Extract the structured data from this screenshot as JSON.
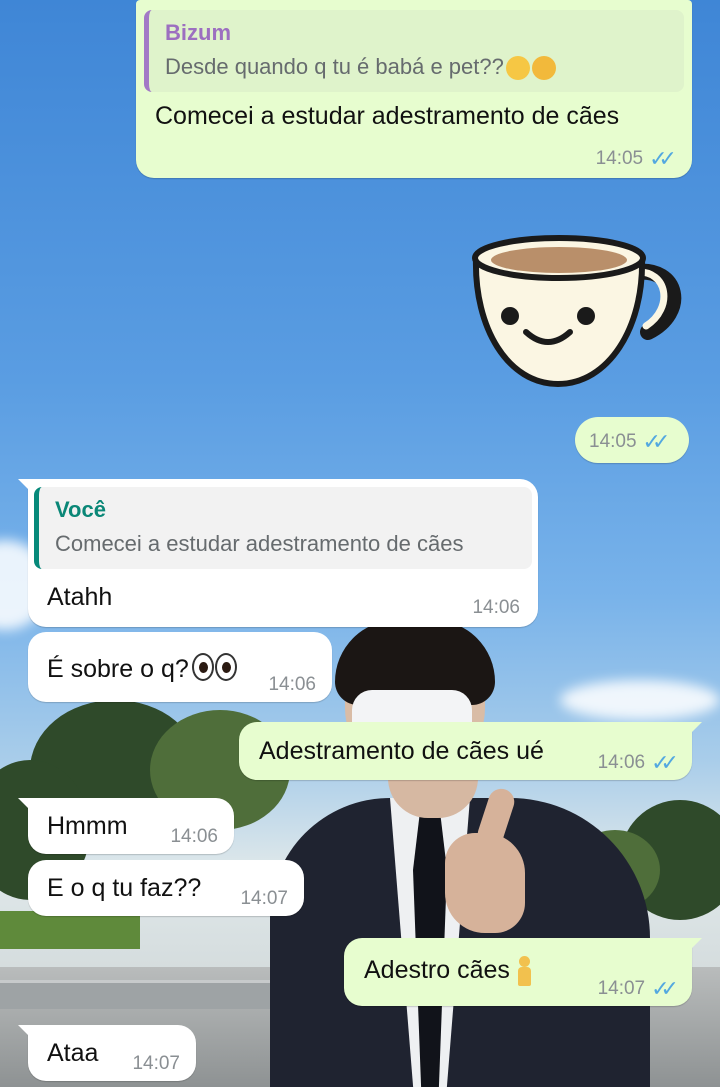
{
  "messages": [
    {
      "id": "m1",
      "direction": "outgoing",
      "quote": {
        "author": "Bizum",
        "text": "Desde quando q tu é babá e pet??",
        "emojis": [
          "face-with-hand-over-mouth",
          "weary-face"
        ]
      },
      "text": "Comecei a estudar adestramento de cães",
      "time": "14:05",
      "status": "read"
    },
    {
      "id": "m2",
      "direction": "outgoing",
      "type": "sticker",
      "sticker": "smiling-coffee-cup",
      "time": "14:05",
      "status": "read"
    },
    {
      "id": "m3",
      "direction": "incoming",
      "quote": {
        "author": "Você",
        "text": "Comecei a estudar adestramento de cães"
      },
      "text": "Atahh",
      "time": "14:06"
    },
    {
      "id": "m4",
      "direction": "incoming",
      "text": "É sobre o q?",
      "emojis": [
        "eyes"
      ],
      "time": "14:06"
    },
    {
      "id": "m5",
      "direction": "outgoing",
      "text": "Adestramento de cães ué",
      "time": "14:06",
      "status": "read"
    },
    {
      "id": "m6",
      "direction": "incoming",
      "text": "Hmmm",
      "time": "14:06"
    },
    {
      "id": "m7",
      "direction": "incoming",
      "text": "E o q tu faz??",
      "time": "14:07"
    },
    {
      "id": "m8",
      "direction": "outgoing",
      "text": "Adestro cães",
      "emojis": [
        "person-standing"
      ],
      "time": "14:07",
      "status": "read"
    },
    {
      "id": "m9",
      "direction": "incoming",
      "text": "Ataa",
      "time": "14:07"
    }
  ],
  "colors": {
    "outgoing_bubble": "#e7fdcf",
    "incoming_bubble": "#ffffff",
    "read_ticks": "#53a8e0",
    "quote_author_bizum": "#9c6fc0",
    "quote_author_voce": "#0a8777"
  },
  "icons": {
    "read_status": "double-check-icon"
  }
}
